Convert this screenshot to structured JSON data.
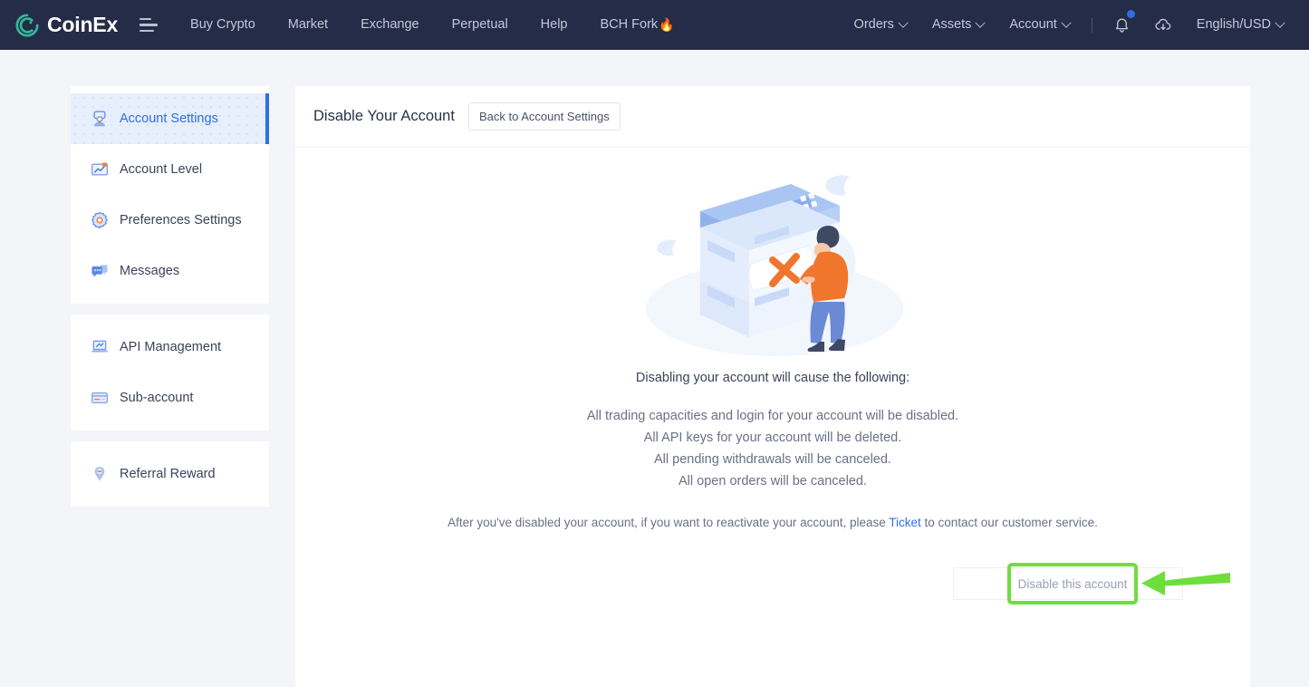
{
  "brand": {
    "name": "CoinEx",
    "logo_icon": "coinex-logo-icon"
  },
  "topnav": {
    "menu_icon": "hamburger-menu-icon",
    "left_links": [
      {
        "label": "Buy Crypto",
        "name": "nav-buy-crypto"
      },
      {
        "label": "Market",
        "name": "nav-market"
      },
      {
        "label": "Exchange",
        "name": "nav-exchange"
      },
      {
        "label": "Perpetual",
        "name": "nav-perpetual"
      },
      {
        "label": "Help",
        "name": "nav-help"
      },
      {
        "label": "BCH Fork",
        "name": "nav-bch-fork",
        "emoji": "🔥"
      }
    ],
    "right_links": [
      {
        "label": "Orders",
        "name": "nav-orders"
      },
      {
        "label": "Assets",
        "name": "nav-assets"
      },
      {
        "label": "Account",
        "name": "nav-account"
      }
    ],
    "notification_icon": "bell-icon",
    "download_icon": "cloud-download-icon",
    "language": "English/USD"
  },
  "sidebar": {
    "groups": [
      {
        "items": [
          {
            "label": "Account Settings",
            "icon": "user-avatar-icon",
            "active": true
          },
          {
            "label": "Account Level",
            "icon": "chart-growth-icon",
            "active": false
          },
          {
            "label": "Preferences Settings",
            "icon": "gear-icon",
            "active": false
          },
          {
            "label": "Messages",
            "icon": "message-bubble-icon",
            "active": false
          }
        ]
      },
      {
        "items": [
          {
            "label": "API Management",
            "icon": "laptop-icon",
            "active": false
          },
          {
            "label": "Sub-account",
            "icon": "card-icon",
            "active": false
          }
        ]
      },
      {
        "items": [
          {
            "label": "Referral Reward",
            "icon": "gift-balloon-icon",
            "active": false
          }
        ]
      }
    ]
  },
  "content": {
    "title": "Disable Your Account",
    "back_button": "Back to Account Settings",
    "illustration": "server-cabinet-with-person-holding-x-paper-illustration",
    "lead": "Disabling your account will cause the following:",
    "consequences": [
      "All trading capacities and login for your account will be disabled.",
      "All API keys for your account will be deleted.",
      "All pending withdrawals will be canceled.",
      "All open orders will be canceled."
    ],
    "note": {
      "before": "After you've disabled your account, if you want to reactivate your account, please ",
      "link": "Ticket",
      "after": " to contact our customer service."
    },
    "disable_button": "Disable this account"
  },
  "annotation": {
    "highlight_color": "#6ede3c",
    "arrow_icon": "left-pointing-arrow-annotation"
  },
  "colors": {
    "nav_background": "#242c47",
    "accent_blue": "#2f6fe4",
    "page_background": "#f4f5f8",
    "brand_green": "#33b899"
  }
}
